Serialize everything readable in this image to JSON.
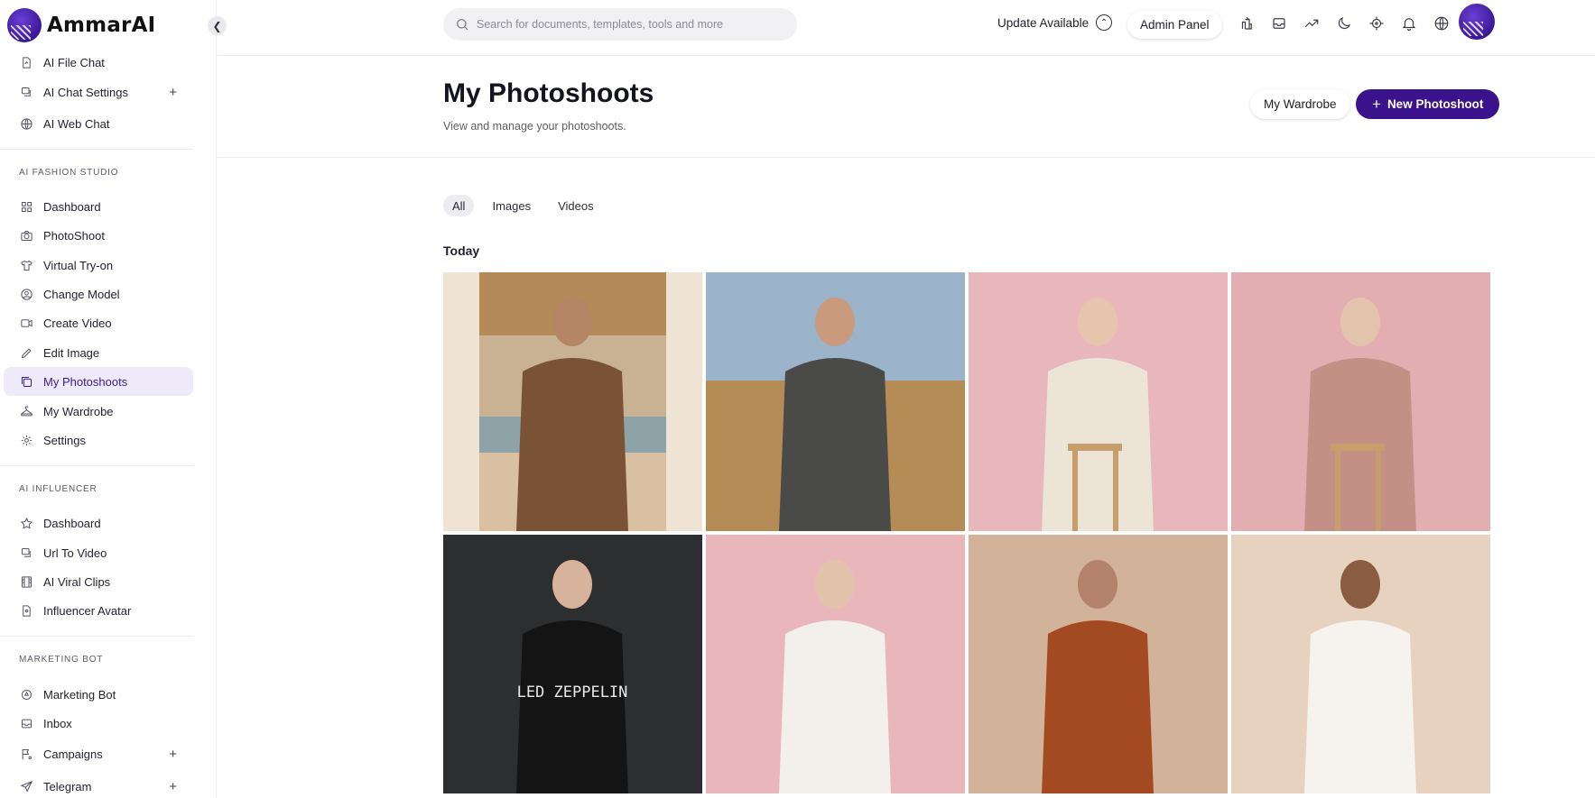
{
  "app": {
    "name": "AmmarAI"
  },
  "sidebar": {
    "top_items": [
      {
        "label": "AI File Chat",
        "icon": "file-chat-icon"
      },
      {
        "label": "AI Chat Settings",
        "icon": "chat-settings-icon",
        "has_plus": true
      },
      {
        "label": "AI Web Chat",
        "icon": "globe-web-icon"
      }
    ],
    "sections": [
      {
        "label": "AI FASHION STUDIO",
        "items": [
          {
            "label": "Dashboard",
            "icon": "dashboard-grid-icon"
          },
          {
            "label": "PhotoShoot",
            "icon": "camera-icon"
          },
          {
            "label": "Virtual Try-on",
            "icon": "shirt-icon"
          },
          {
            "label": "Change Model",
            "icon": "user-circle-icon"
          },
          {
            "label": "Create Video",
            "icon": "video-icon"
          },
          {
            "label": "Edit Image",
            "icon": "pencil-icon"
          },
          {
            "label": "My Photoshoots",
            "icon": "gallery-icon",
            "active": true
          },
          {
            "label": "My Wardrobe",
            "icon": "hanger-icon"
          },
          {
            "label": "Settings",
            "icon": "gear-icon"
          }
        ]
      },
      {
        "label": "AI INFLUENCER",
        "items": [
          {
            "label": "Dashboard",
            "icon": "star-icon"
          },
          {
            "label": "Url To Video",
            "icon": "link-video-icon"
          },
          {
            "label": "AI Viral Clips",
            "icon": "film-icon"
          },
          {
            "label": "Influencer Avatar",
            "icon": "avatar-file-icon"
          }
        ]
      },
      {
        "label": "MARKETING BOT",
        "items": [
          {
            "label": "Marketing Bot",
            "icon": "bot-icon"
          },
          {
            "label": "Inbox",
            "icon": "inbox-icon"
          },
          {
            "label": "Campaigns",
            "icon": "flag-icon",
            "has_plus": true
          },
          {
            "label": "Telegram",
            "icon": "send-icon",
            "has_plus": true
          }
        ]
      }
    ]
  },
  "topbar": {
    "search_placeholder": "Search for documents, templates, tools and more",
    "update_label": "Update Available",
    "admin_label": "Admin Panel",
    "icons": [
      "affiliate-icon",
      "mail-icon",
      "trending-icon",
      "moon-icon",
      "crosshair-icon",
      "bell-icon",
      "globe-icon"
    ]
  },
  "page": {
    "title": "My Photoshoots",
    "subtitle": "View and manage your photoshoots.",
    "wardrobe_button": "My Wardrobe",
    "new_button": "New Photoshoot",
    "tabs": [
      {
        "label": "All",
        "active": true
      },
      {
        "label": "Images",
        "active": false
      },
      {
        "label": "Videos",
        "active": false
      }
    ],
    "group_label": "Today",
    "photos": [
      {
        "alt": "Man in brown shirt on beach cabana",
        "bg": "#c9b193",
        "accent": "#7a5236",
        "skin": "#b58566"
      },
      {
        "alt": "Man in gray hoodie in wheat field",
        "bg": "#b99460",
        "accent": "#4a4a48",
        "skin": "#c99a7d"
      },
      {
        "alt": "Woman in cream blouse on stool",
        "bg": "#e7b7bb",
        "accent": "#ebe4d7",
        "skin": "#e6c4ae"
      },
      {
        "alt": "Woman in pink trousers on stool",
        "bg": "#e3aeb2",
        "accent": "#c49086",
        "skin": "#e4c3ad"
      },
      {
        "alt": "Blond man in Led Zeppelin t-shirt",
        "bg": "#2e2f31",
        "accent": "#141414",
        "skin": "#d8b39c"
      },
      {
        "alt": "Woman in white dress on pink",
        "bg": "#e9b7bb",
        "accent": "#f3f0eb",
        "skin": "#e3c2ac"
      },
      {
        "alt": "Woman in rust suit",
        "bg": "#d2b39a",
        "accent": "#a34a22",
        "skin": "#b4826a"
      },
      {
        "alt": "Woman in white off-shoulder gown",
        "bg": "#e6d2bf",
        "accent": "#f6f3ef",
        "skin": "#8a5c42"
      }
    ],
    "tshirt_print": "LED ZEPPELIN"
  }
}
